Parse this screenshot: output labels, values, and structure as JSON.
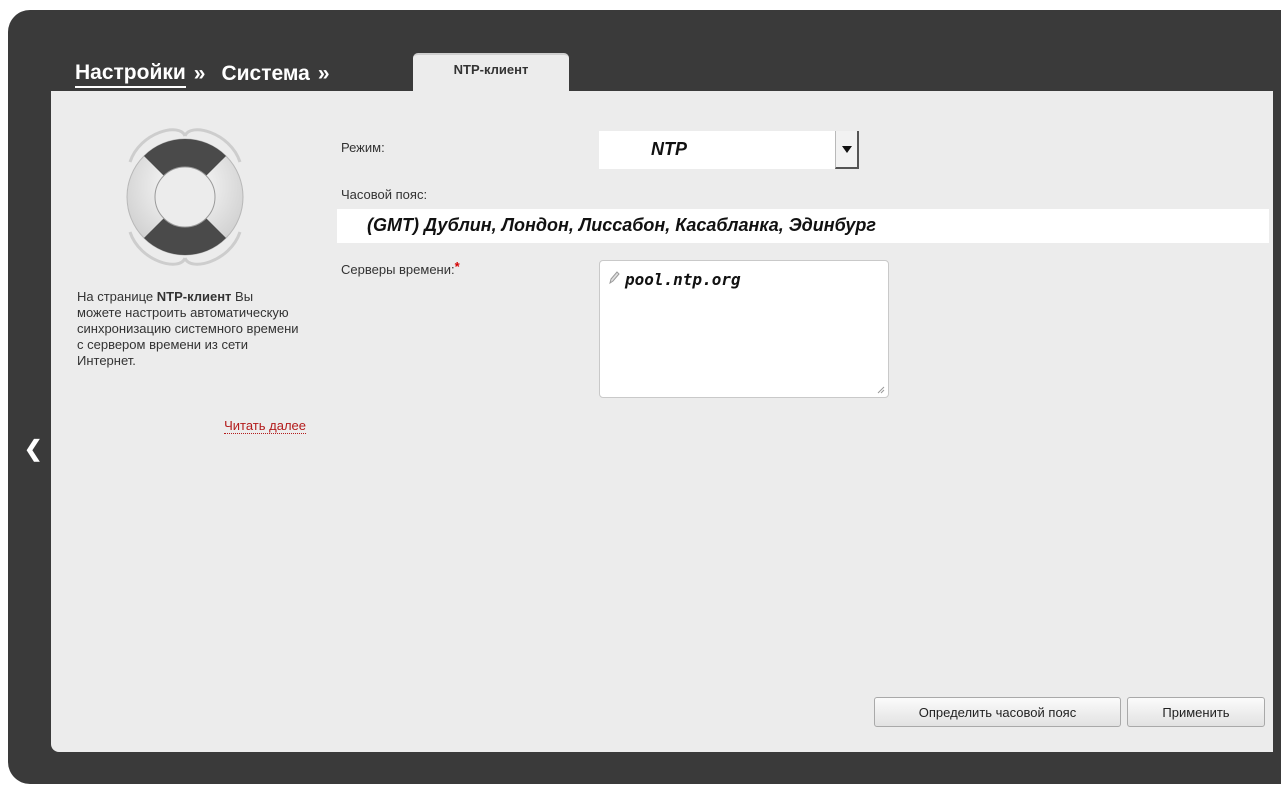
{
  "breadcrumb": {
    "item1": "Настройки",
    "sep1": "»",
    "item2": "Система",
    "sep2": "»",
    "active_tab": "NTP-клиент"
  },
  "help": {
    "text_before": "На странице ",
    "text_bold": "NTP-клиент",
    "text_after": " Вы можете настроить автоматическую синхронизацию системного времени с сервером времени из сети Интернет.",
    "read_more": "Читать далее",
    "icon": "lifebuoy-icon"
  },
  "form": {
    "mode_label": "Режим:",
    "mode_value": "NTP",
    "timezone_label": "Часовой пояс:",
    "timezone_value": "(GMT) Дублин, Лондон, Лиссабон, Касабланка, Эдинбург",
    "servers_label": "Серверы времени:",
    "servers_required": "*",
    "servers_value": "pool.ntp.org"
  },
  "buttons": {
    "detect_timezone": "Определить часовой пояс",
    "apply": "Применить"
  },
  "nav": {
    "back_icon": "back-arrow-icon",
    "back_glyph": "❮"
  },
  "colors": {
    "frame": "#3a3a3a",
    "panel": "#ececec",
    "link": "#b31b1b",
    "required": "#d40000"
  }
}
